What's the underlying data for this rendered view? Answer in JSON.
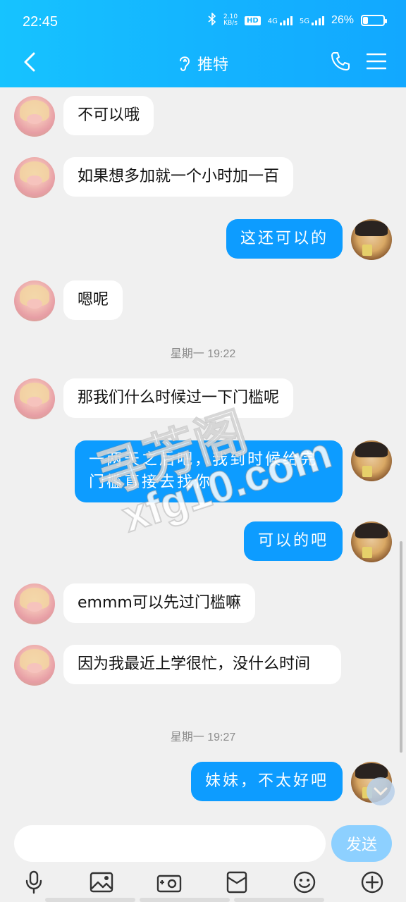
{
  "status_bar": {
    "time": "22:45",
    "net_speed_top": "2.10",
    "net_speed_bottom": "KB/s",
    "hd": "HD",
    "net_4g": "4G",
    "net_5g": "5G",
    "battery_percent": "26%",
    "battery_level": 0.26
  },
  "header": {
    "title": "推特",
    "icons": [
      "back-arrow-icon",
      "ear-icon",
      "phone-icon",
      "menu-icon"
    ]
  },
  "messages": [
    {
      "side": "in",
      "text": "不可以哦"
    },
    {
      "side": "in",
      "text": "如果想多加就一个小时加一百"
    },
    {
      "side": "out",
      "text": "这还可以的"
    },
    {
      "side": "in",
      "text": "嗯呢"
    },
    {
      "side": "in",
      "text": "那我们什么时候过一下门槛呢"
    },
    {
      "side": "out",
      "text": "一两天之后吧，我到时候给完门槛直接去找你"
    },
    {
      "side": "out",
      "text": "可以的吧"
    },
    {
      "side": "in",
      "text": "emmm可以先过门槛嘛"
    },
    {
      "side": "in",
      "text": "因为我最近上学很忙，没什么时间"
    },
    {
      "side": "out",
      "text": "妹妹，不太好吧"
    }
  ],
  "timestamps": [
    "星期一 19:22",
    "星期一 19:27"
  ],
  "watermark": {
    "line1": "寻芳阁",
    "line2": "xfg10.com"
  },
  "composer": {
    "input_value": "",
    "send_label": "发送",
    "tools": [
      "microphone-icon",
      "image-icon",
      "camera-icon",
      "red-packet-icon",
      "emoji-icon",
      "plus-icon"
    ]
  },
  "colors": {
    "header": "#14b4ff",
    "outgoing_bubble": "#0d9cff",
    "incoming_bubble": "#ffffff",
    "background": "#f0f0f0",
    "send_button": "#8dd0ff"
  }
}
